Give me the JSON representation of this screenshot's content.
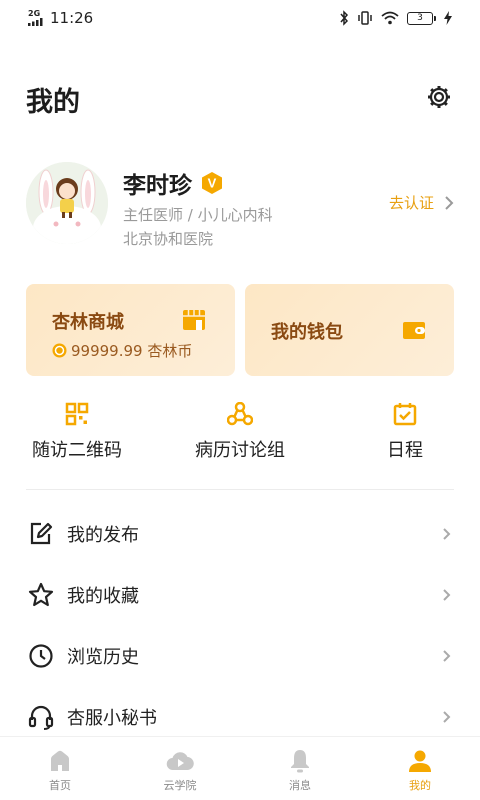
{
  "status_bar": {
    "network": "2G",
    "time": "11:26",
    "battery": "3"
  },
  "header": {
    "title": "我的"
  },
  "profile": {
    "name": "李时珍",
    "badge": "V",
    "title": "主任医师 / 小儿心内科",
    "hospital": "北京协和医院",
    "verify_label": "去认证"
  },
  "cards": {
    "mall": {
      "title": "杏林商城",
      "balance": "99999.99 杏林币"
    },
    "wallet": {
      "title": "我的钱包"
    }
  },
  "quick_actions": [
    {
      "label": "随访二维码",
      "icon": "qr-code-icon"
    },
    {
      "label": "病历讨论组",
      "icon": "group-icon"
    },
    {
      "label": "日程",
      "icon": "calendar-icon"
    }
  ],
  "menu": [
    {
      "label": "我的发布",
      "icon": "edit-icon"
    },
    {
      "label": "我的收藏",
      "icon": "star-icon"
    },
    {
      "label": "浏览历史",
      "icon": "clock-icon"
    },
    {
      "label": "杏服小秘书",
      "icon": "headset-icon"
    }
  ],
  "tabbar": [
    {
      "label": "首页",
      "icon": "home-icon",
      "active": false
    },
    {
      "label": "云学院",
      "icon": "cloud-play-icon",
      "active": false
    },
    {
      "label": "消息",
      "icon": "bell-icon",
      "active": false
    },
    {
      "label": "我的",
      "icon": "user-icon",
      "active": true
    }
  ],
  "colors": {
    "accent": "#F5A800",
    "accent_text": "#E8A012",
    "card_title": "#8A4A12",
    "tab_inactive": "#C8C8C8"
  }
}
